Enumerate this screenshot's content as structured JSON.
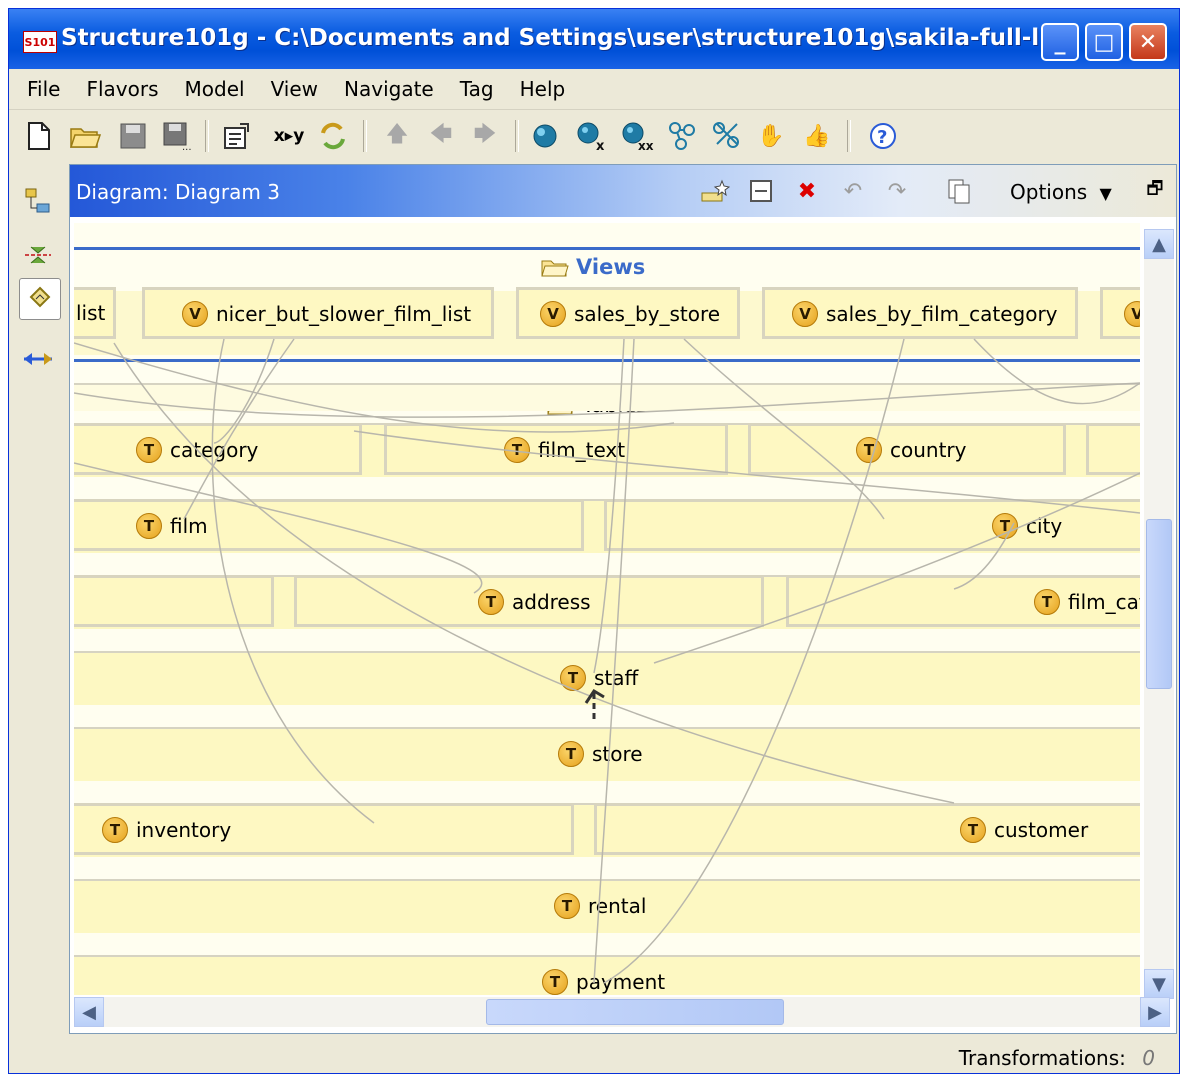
{
  "window": {
    "app_icon": "S101",
    "title": "Structure101g - C:\\Documents and Settings\\user\\structure101g\\sakila-full-l...",
    "controls": {
      "minimize": "_",
      "maximize": "□",
      "close": "✕"
    }
  },
  "menu": [
    "File",
    "Flavors",
    "Model",
    "View",
    "Navigate",
    "Tag",
    "Help"
  ],
  "toolbar": {
    "new": "new-file-icon",
    "open": "open-folder-icon",
    "save": "save-icon",
    "save_as": "save-as-icon",
    "properties": "properties-icon",
    "xy_label": "x▸y",
    "refresh": "refresh-icon",
    "up": "arrow-up-icon",
    "back": "arrow-left-icon",
    "forward": "arrow-right-icon",
    "help": "help-icon"
  },
  "diagram": {
    "title": "Diagram: Diagram 3",
    "options_label": "Options",
    "views_section": "Views",
    "tables_section": "Tables",
    "views": [
      "list",
      "nicer_but_slower_film_list",
      "sales_by_store",
      "sales_by_film_category"
    ],
    "tables": {
      "category": "category",
      "film_text": "film_text",
      "country": "country",
      "film": "film",
      "city": "city",
      "address": "address",
      "film_cat": "film_cat",
      "staff": "staff",
      "store": "store",
      "inventory": "inventory",
      "customer": "customer",
      "rental": "rental",
      "payment": "payment"
    },
    "badge_view": "V",
    "badge_table": "T"
  },
  "status": {
    "label": "Transformations:",
    "value": "0"
  },
  "colors": {
    "title_bar": "#0a5ce0",
    "canvas": "#fffef0",
    "row": "#fdf8c2",
    "badge": "#e5a11c",
    "section_line": "#3b6bc9"
  }
}
